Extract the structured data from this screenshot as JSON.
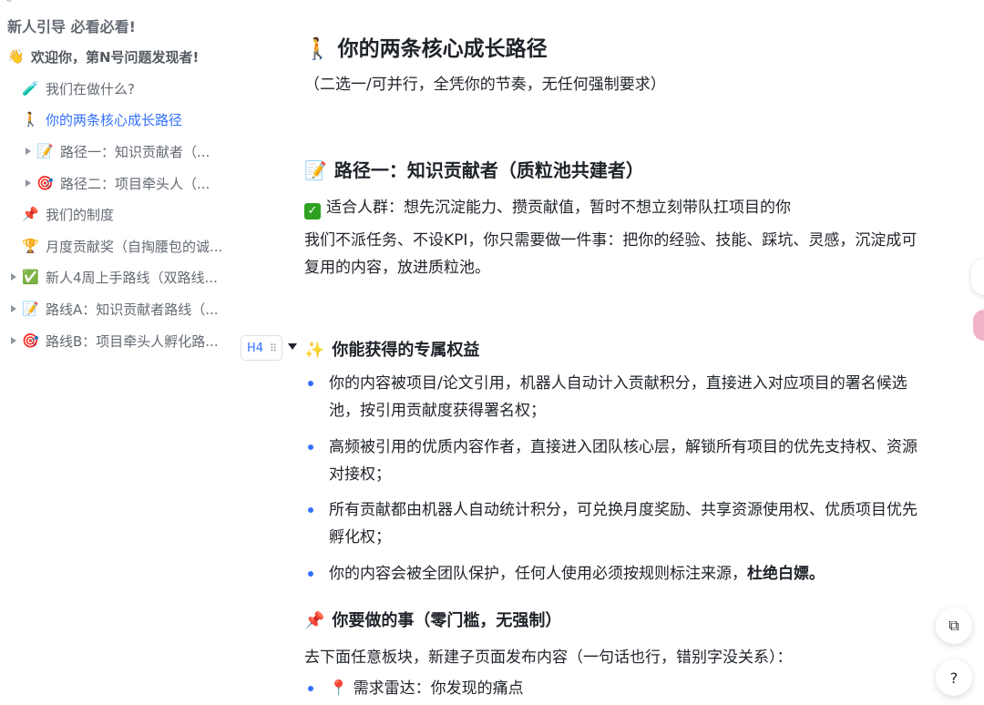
{
  "sidebar": {
    "title": "新人引导 必看必看!",
    "items": [
      {
        "emoji": "👋",
        "label": "欢迎你，第N号问题发现者!"
      },
      {
        "emoji": "🧪",
        "label": "我们在做什么?"
      },
      {
        "emoji": "🚶",
        "label": "你的两条核心成长路径"
      },
      {
        "emoji": "📝",
        "label": "路径一：知识贡献者（..."
      },
      {
        "emoji": "🎯",
        "label": "路径二：项目牵头人（..."
      },
      {
        "emoji": "📌",
        "label": "我们的制度"
      },
      {
        "emoji": "🏆",
        "label": "月度贡献奖（自掏腰包的诚..."
      },
      {
        "emoji": "✅",
        "label": "新人4周上手路线（双路线..."
      },
      {
        "emoji": "📝",
        "label": "路线A：知识贡献者路线（..."
      },
      {
        "emoji": "🎯",
        "label": "路线B：项目牵头人孵化路..."
      }
    ]
  },
  "heading_tools": {
    "level_label": "H4",
    "drag_icon": "⠿"
  },
  "doc": {
    "h2": {
      "emoji": "🚶",
      "text": "你的两条核心成长路径"
    },
    "subtitle": "（二选一/可并行，全凭你的节奏，无任何强制要求）",
    "path1": {
      "emoji": "📝",
      "title": "路径一：知识贡献者（质粒池共建者）",
      "audience": "适合人群：想先沉淀能力、攒贡献值，暂时不想立刻带队扛项目的你",
      "desc": "我们不派任务、不设KPI，你只需要做一件事：把你的经验、技能、踩坑、灵感，沉淀成可复用的内容，放进质粒池。"
    },
    "benefits": {
      "emoji": "✨",
      "title": "你能获得的专属权益",
      "items": [
        "你的内容被项目/论文引用，机器人自动计入贡献积分，直接进入对应项目的署名候选池，按引用贡献度获得署名权；",
        "高频被引用的优质内容作者，直接进入团队核心层，解锁所有项目的优先支持权、资源对接权；",
        "所有贡献都由机器人自动统计积分，可兑换月度奖励、共享资源使用权、优质项目优先孵化权；"
      ],
      "last_item": "你的内容会被全团队保护，任何人使用必须按规则标注来源，",
      "last_item_bold": "杜绝白嫖。"
    },
    "todo": {
      "emoji": "📌",
      "title": "你要做的事（零门槛，无强制）",
      "desc": "去下面任意板块，新建子页面发布内容（一句话也行，错别字没关系）：",
      "first_item_emoji": "📍",
      "first_item": "需求雷达：你发现的痛点"
    }
  },
  "floating": {
    "copy_icon": "⧉",
    "help_icon": "?"
  }
}
